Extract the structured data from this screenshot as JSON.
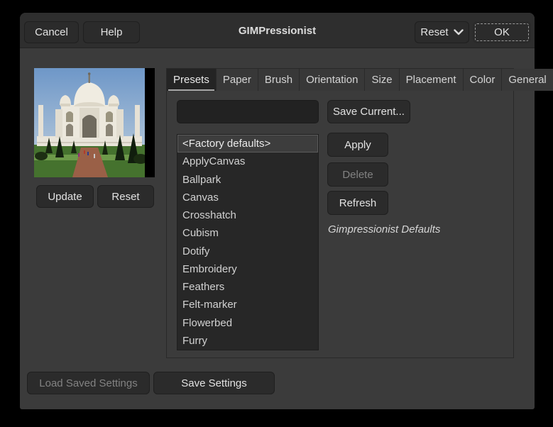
{
  "window": {
    "title": "GIMPressionist"
  },
  "header": {
    "cancel_label": "Cancel",
    "help_label": "Help",
    "reset_menu_label": "Reset",
    "ok_label": "OK"
  },
  "preview_panel": {
    "image_alt": "taj-mahal-photo-preview",
    "update_label": "Update",
    "reset_label": "Reset"
  },
  "tabs": {
    "labels": [
      "Presets",
      "Paper",
      "Brush",
      "Orientation",
      "Size",
      "Placement",
      "Color",
      "General"
    ],
    "active_index": 0
  },
  "presets_tab": {
    "name_entry_value": "",
    "save_current_label": "Save Current...",
    "preset_list": [
      "<Factory defaults>",
      "ApplyCanvas",
      "Ballpark",
      "Canvas",
      "Crosshatch",
      "Cubism",
      "Dotify",
      "Embroidery",
      "Feathers",
      "Felt-marker",
      "Flowerbed",
      "Furry"
    ],
    "selected_index": 0,
    "apply_label": "Apply",
    "delete_label": "Delete",
    "delete_disabled": true,
    "refresh_label": "Refresh",
    "description": "Gimpressionist Defaults"
  },
  "footer": {
    "load_label": "Load Saved Settings",
    "load_disabled": true,
    "save_label": "Save Settings"
  },
  "colors": {
    "dialog_bg": "#3b3b3b",
    "header_bg": "#2e2e2e",
    "button_bg": "#2b2b2b",
    "list_bg": "#272727",
    "selected_row_bg": "#3d3d3d",
    "text": "#e2e2e2",
    "disabled_text": "#828282",
    "outer_bg": "#000000"
  }
}
